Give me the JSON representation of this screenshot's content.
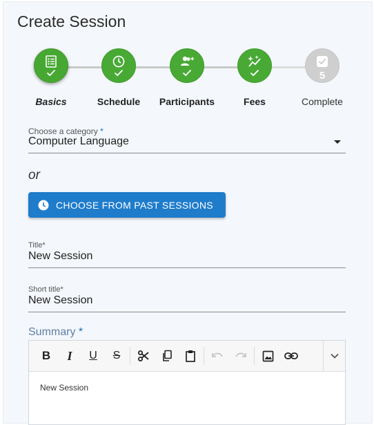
{
  "page": {
    "title": "Create Session"
  },
  "stepper": {
    "steps": [
      {
        "label": "Basics",
        "icon": "list-icon",
        "state": "active"
      },
      {
        "label": "Schedule",
        "icon": "clock-icon",
        "state": "done"
      },
      {
        "label": "Participants",
        "icon": "person-add-icon",
        "state": "done"
      },
      {
        "label": "Fees",
        "icon": "sparkle-chart-icon",
        "state": "done"
      },
      {
        "label": "Complete",
        "icon": "check-icon",
        "number": "5",
        "state": "pending"
      }
    ]
  },
  "category": {
    "label": "Choose a category",
    "required_mark": "*",
    "value": "Computer Language"
  },
  "or_text": "or",
  "past_sessions_button": {
    "label": "CHOOSE FROM PAST SESSIONS"
  },
  "title_field": {
    "label": "Title",
    "required_mark": "*",
    "value": "New Session"
  },
  "short_title_field": {
    "label": "Short title",
    "required_mark": "*",
    "value": "New Session"
  },
  "summary": {
    "label": "Summary",
    "required_mark": "*",
    "content": "New Session",
    "toolbar": [
      "bold",
      "italic",
      "underline",
      "strikethrough",
      "cut",
      "copy",
      "paste",
      "undo",
      "redo",
      "image",
      "link",
      "more"
    ]
  },
  "colors": {
    "accent": "#1e7ccb",
    "step_green": "#46a832",
    "step_pending": "#cfcfcf"
  }
}
